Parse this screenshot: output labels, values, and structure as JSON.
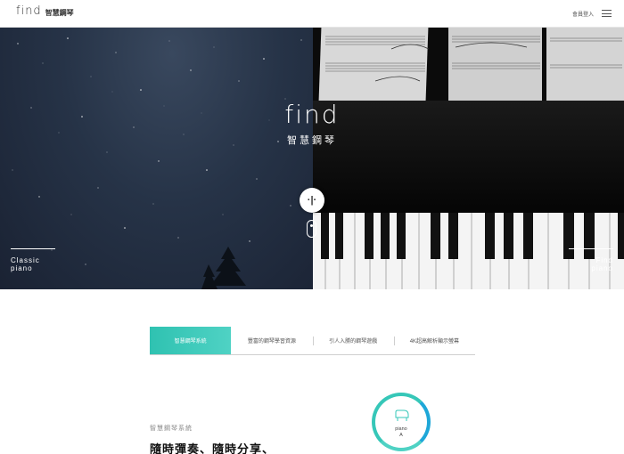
{
  "header": {
    "logo_word": "find",
    "logo_sub": "智慧鋼琴",
    "login_label": "會員登入"
  },
  "hero": {
    "center_word": "find",
    "center_sub": "智慧鋼琴",
    "left_label_line1": "Classic",
    "left_label_line2": "piano",
    "right_label_line1": "Find",
    "right_label_line2": "piano",
    "handle_glyph": "·|·"
  },
  "tabs": [
    {
      "label": "智慧鋼琴系統",
      "active": true
    },
    {
      "label": "豐富的鋼琴學習資源",
      "active": false
    },
    {
      "label": "引人入勝的鋼琴遊戲",
      "active": false
    },
    {
      "label": "4K超高解析顯示螢幕",
      "active": false
    }
  ],
  "content": {
    "section_label": "智慧鋼琴系統",
    "section_title": "隨時彈奏、隨時分享、",
    "product_line1": "piano",
    "product_line2": "A"
  },
  "colors": {
    "accent": "#36c7b8",
    "accent_alt": "#1ea7d8",
    "night_sky": "#263347"
  }
}
